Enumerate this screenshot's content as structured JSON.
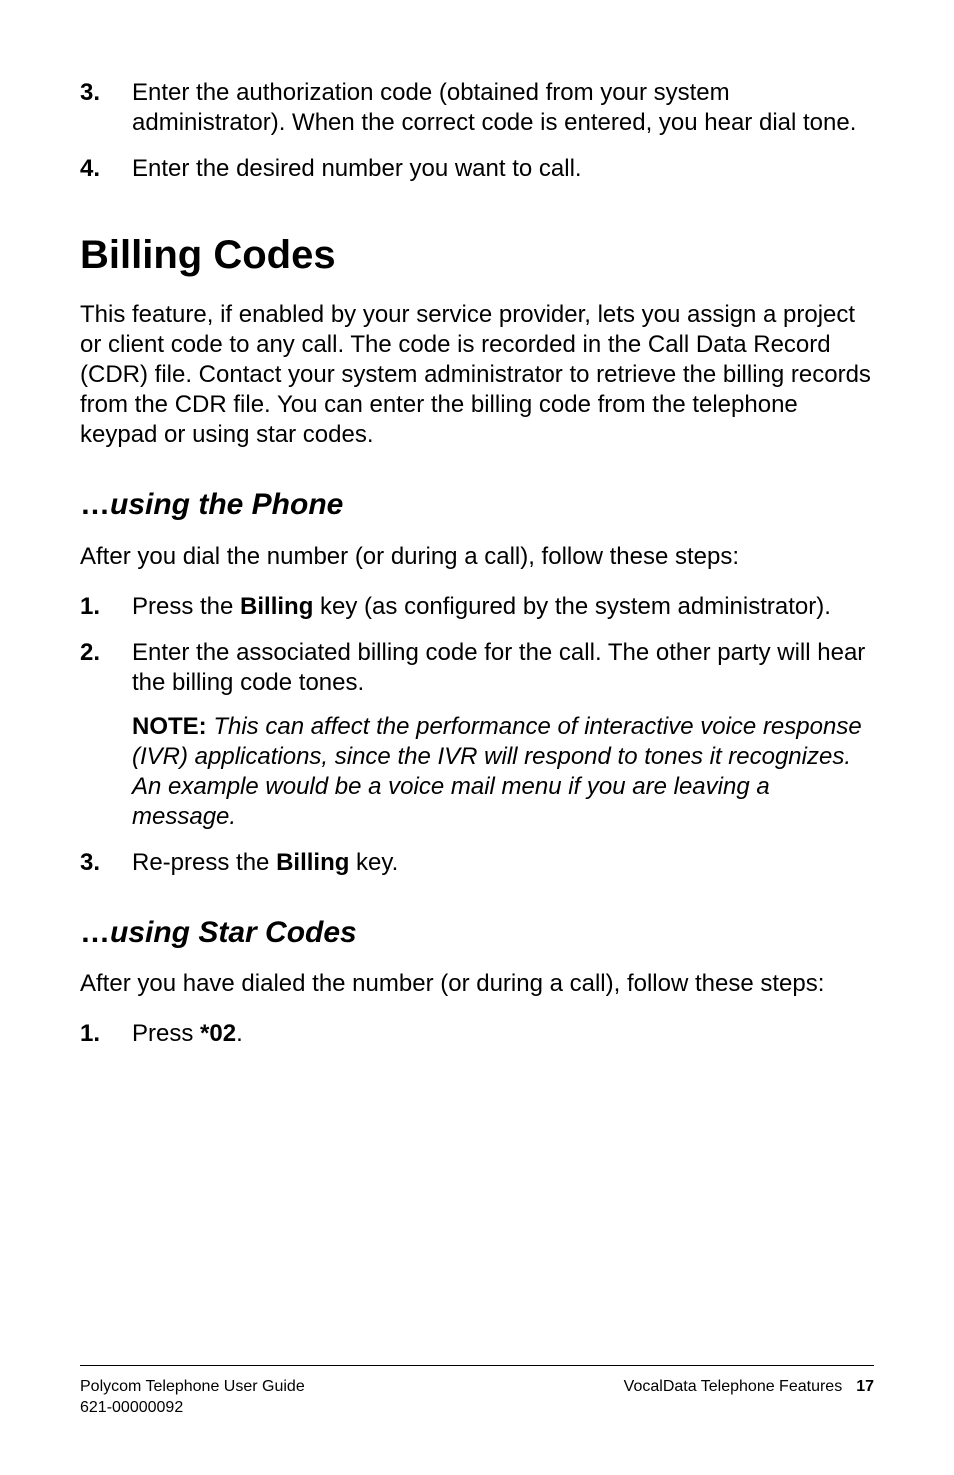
{
  "top_list": [
    {
      "num": "3.",
      "text_parts": [
        {
          "t": "Enter the authorization code (obtained from your system administrator). When the correct code is entered, you hear dial tone."
        }
      ]
    },
    {
      "num": "4.",
      "text_parts": [
        {
          "t": "Enter the desired number you want to call."
        }
      ]
    }
  ],
  "section": {
    "title": "Billing Codes",
    "intro": "This feature, if enabled by your service provider, lets you assign a project or client code to any call. The code is recorded in the Call Data Record (CDR) file. Contact your system administrator to retrieve the billing records from the CDR file. You can enter the billing code from the telephone keypad or using star codes."
  },
  "sub_phone": {
    "dots": "…",
    "title": "using the Phone",
    "intro": "After you dial the number (or during a call), follow these steps:",
    "items": [
      {
        "num": "1.",
        "text_parts": [
          {
            "t": "Press the "
          },
          {
            "t": "Billing",
            "bold": true
          },
          {
            "t": " key (as configured by the system administrator)."
          }
        ]
      },
      {
        "num": "2.",
        "text_parts": [
          {
            "t": "Enter the associated billing code for the call. The other party will hear the billing code tones."
          }
        ],
        "note": {
          "label": "NOTE:",
          "text": " This can affect the performance of interactive voice response (IVR) applications, since the IVR will respond to tones it recognizes. An example would be a voice mail menu if you are leaving a message."
        }
      },
      {
        "num": "3.",
        "text_parts": [
          {
            "t": "Re-press the "
          },
          {
            "t": "Billing",
            "bold": true
          },
          {
            "t": " key."
          }
        ]
      }
    ]
  },
  "sub_star": {
    "dots": "…",
    "title": "using Star Codes",
    "intro": "After you have dialed the number (or during a call), follow these steps:",
    "items": [
      {
        "num": "1.",
        "text_parts": [
          {
            "t": "Press "
          },
          {
            "t": "*02",
            "bold": true
          },
          {
            "t": "."
          }
        ]
      }
    ]
  },
  "footer": {
    "left_line1": "Polycom Telephone User Guide",
    "left_line2": "621-00000092",
    "right_text": "VocalData Telephone Features",
    "page_number": "17"
  }
}
